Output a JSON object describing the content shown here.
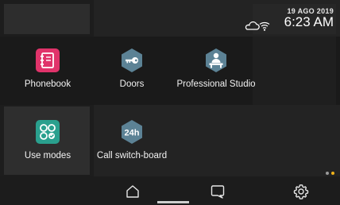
{
  "status_bar": {
    "date": "19 AGO 2019",
    "time": "6:23 AM",
    "icons": [
      "cloud-icon",
      "wifi-icon"
    ]
  },
  "apps": [
    {
      "label": "Phonebook",
      "icon": "phonebook-icon",
      "color": "#e0336a"
    },
    {
      "label": "Doors",
      "icon": "doors-key-icon",
      "color": "#5c8295"
    },
    {
      "label": "Professional Studio",
      "icon": "professional-studio-icon",
      "color": "#5c8295"
    },
    {
      "label": "Use modes",
      "icon": "use-modes-icon",
      "color": "#2aa08e"
    },
    {
      "label": "Call switch-board",
      "icon": "call-switchboard-24h-icon",
      "badge": "24h",
      "color": "#5c8295"
    }
  ],
  "pager": {
    "active_page": 2,
    "pages": 2,
    "active_color": "#f0b21a",
    "inactive_color": "#9a9a9a"
  },
  "nav": {
    "items": [
      "home-icon",
      "messages-icon",
      "settings-icon"
    ]
  }
}
